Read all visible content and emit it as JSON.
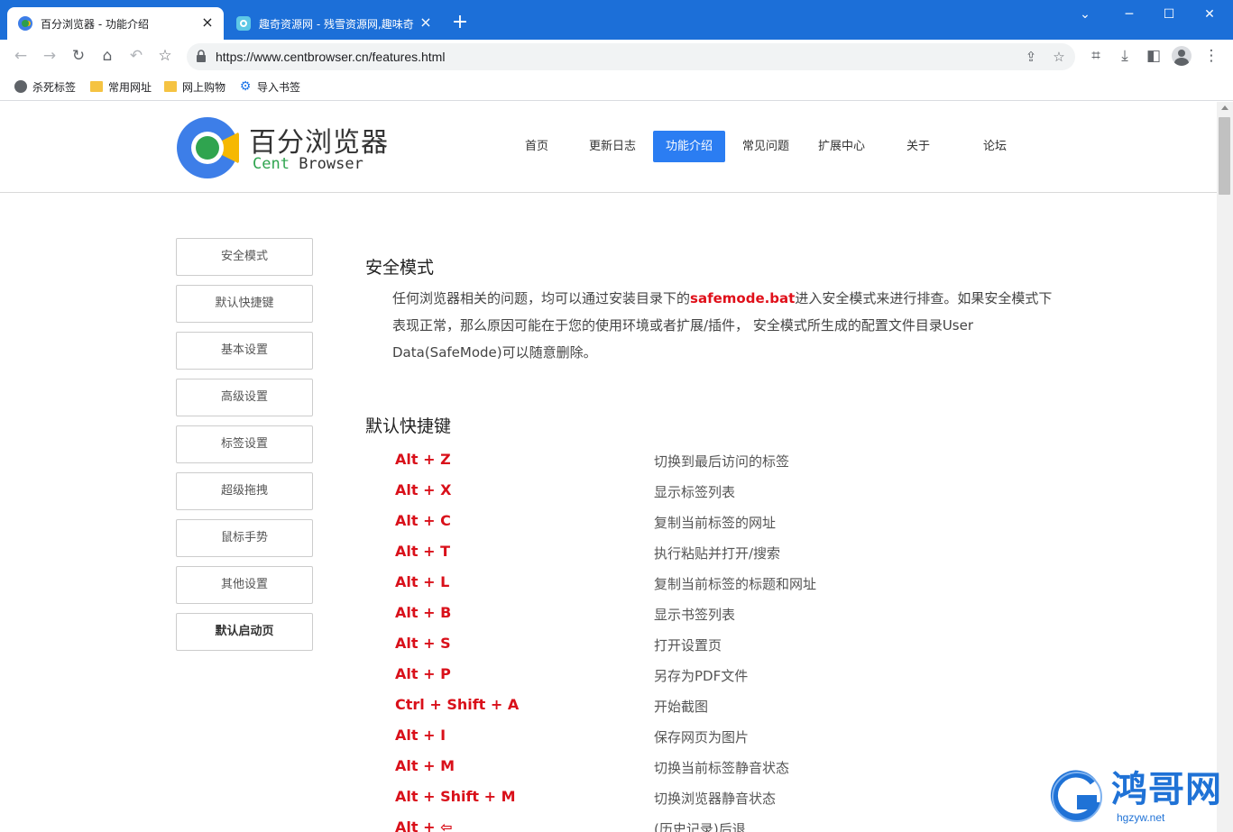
{
  "tabs": [
    {
      "title": "百分浏览器 - 功能介绍",
      "close": "×"
    },
    {
      "title": "趣奇资源网 - 残雪资源网,趣味奇",
      "close": "×"
    }
  ],
  "new_tab": "+",
  "window_controls": {
    "minimize": "─",
    "maximize": "☐",
    "close": "✕",
    "tab_search": "⌄"
  },
  "toolbar": {
    "url": "https://www.centbrowser.cn/features.html",
    "icons": [
      "back-icon",
      "forward-icon",
      "reload-icon",
      "home-icon",
      "undo-close-tab-icon",
      "bookmark-star-icon",
      "share-icon",
      "star-icon",
      "crop-icon",
      "download-icon",
      "side-panel-icon",
      "profile-icon",
      "menu-icon"
    ]
  },
  "bookmarks": [
    {
      "label": "杀死标签",
      "icon": "globe-icon"
    },
    {
      "label": "常用网址",
      "icon": "folder-icon"
    },
    {
      "label": "网上购物",
      "icon": "folder-icon"
    },
    {
      "label": "导入书签",
      "icon": "gear-icon"
    }
  ],
  "site": {
    "logo_cn": "百分浏览器",
    "logo_en_1": "Cent",
    "logo_en_2": " Browser",
    "nav": [
      "首页",
      "更新日志",
      "功能介绍",
      "常见问题",
      "扩展中心",
      "关于",
      "论坛"
    ],
    "nav_active": "功能介绍"
  },
  "sidebar": [
    "安全模式",
    "默认快捷键",
    "基本设置",
    "高级设置",
    "标签设置",
    "超级拖拽",
    "鼠标手势",
    "其他设置",
    "默认启动页"
  ],
  "content": {
    "safe_mode_title": "安全模式",
    "safe_mode_text_1": "任何浏览器相关的问题，均可以通过安装目录下的",
    "safe_mode_highlight": "safemode.bat",
    "safe_mode_text_2": "进入安全模式来进行排查。如果安全模式下表现正常，那么原因可能在于您的使用环境或者扩展/插件， 安全模式所生成的配置文件目录User Data(SafeMode)可以随意删除。",
    "shortcuts_title": "默认快捷键",
    "shortcuts": [
      {
        "key": "Alt + Z",
        "desc": "切换到最后访问的标签"
      },
      {
        "key": "Alt + X",
        "desc": "显示标签列表"
      },
      {
        "key": "Alt + C",
        "desc": "复制当前标签的网址"
      },
      {
        "key": "Alt + T",
        "desc": "执行粘贴并打开/搜索"
      },
      {
        "key": "Alt + L",
        "desc": "复制当前标签的标题和网址"
      },
      {
        "key": "Alt + B",
        "desc": "显示书签列表"
      },
      {
        "key": "Alt + S",
        "desc": "打开设置页"
      },
      {
        "key": "Alt + P",
        "desc": "另存为PDF文件"
      },
      {
        "key": "Ctrl + Shift + A",
        "desc": "开始截图"
      },
      {
        "key": "Alt + I",
        "desc": "保存网页为图片"
      },
      {
        "key": "Alt + M",
        "desc": "切换当前标签静音状态"
      },
      {
        "key": "Alt + Shift + M",
        "desc": "切换浏览器静音状态"
      },
      {
        "key": "Alt + ⇦",
        "desc": "(历史记录)后退"
      }
    ]
  },
  "watermark": {
    "title": "鸿哥网",
    "sub": "hgzyw.net"
  },
  "colors": {
    "tabstrip": "#1c6fd8",
    "accent": "#2b7df2",
    "shortcut_key": "#d9101a",
    "logo_green": "#2fa44f",
    "logo_blue": "#3d7ee8",
    "logo_yellow": "#f6b800"
  }
}
